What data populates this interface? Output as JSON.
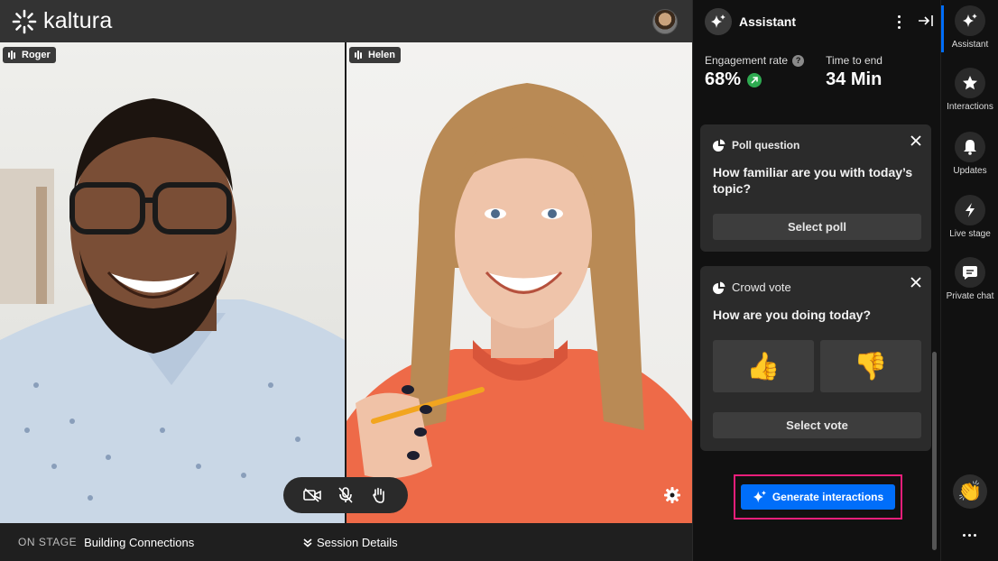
{
  "app": {
    "brand": "kaltura"
  },
  "stage": {
    "participants": [
      {
        "name": "Roger"
      },
      {
        "name": "Helen"
      }
    ]
  },
  "footer": {
    "on_stage_label": "ON STAGE",
    "session_name": "Building Connections",
    "session_details": "Session Details"
  },
  "assistant": {
    "title": "Assistant",
    "metrics": {
      "engagement_label": "Engagement rate",
      "engagement_value": "68%",
      "time_label": "Time to end",
      "time_value": "34 Min"
    },
    "poll_card": {
      "type_label": "Poll question",
      "question": "How familiar are you with today’s topic?",
      "button": "Select poll"
    },
    "vote_card": {
      "type_label": "Crowd vote",
      "question": "How are you doing today?",
      "option_up": "👍",
      "option_down": "👎",
      "button": "Select vote"
    },
    "generate_button": "Generate interactions"
  },
  "rail": {
    "items": [
      {
        "label": "Assistant",
        "icon": "sparkle-icon"
      },
      {
        "label": "Interactions",
        "icon": "star-icon"
      },
      {
        "label": "Updates",
        "icon": "bell-icon"
      },
      {
        "label": "Live stage",
        "icon": "lightning-icon"
      },
      {
        "label": "Private chat",
        "icon": "chat-icon"
      }
    ],
    "reaction": "👏"
  },
  "colors": {
    "accent": "#006efa",
    "highlight": "#e91e7a",
    "positive": "#2eaa51"
  }
}
